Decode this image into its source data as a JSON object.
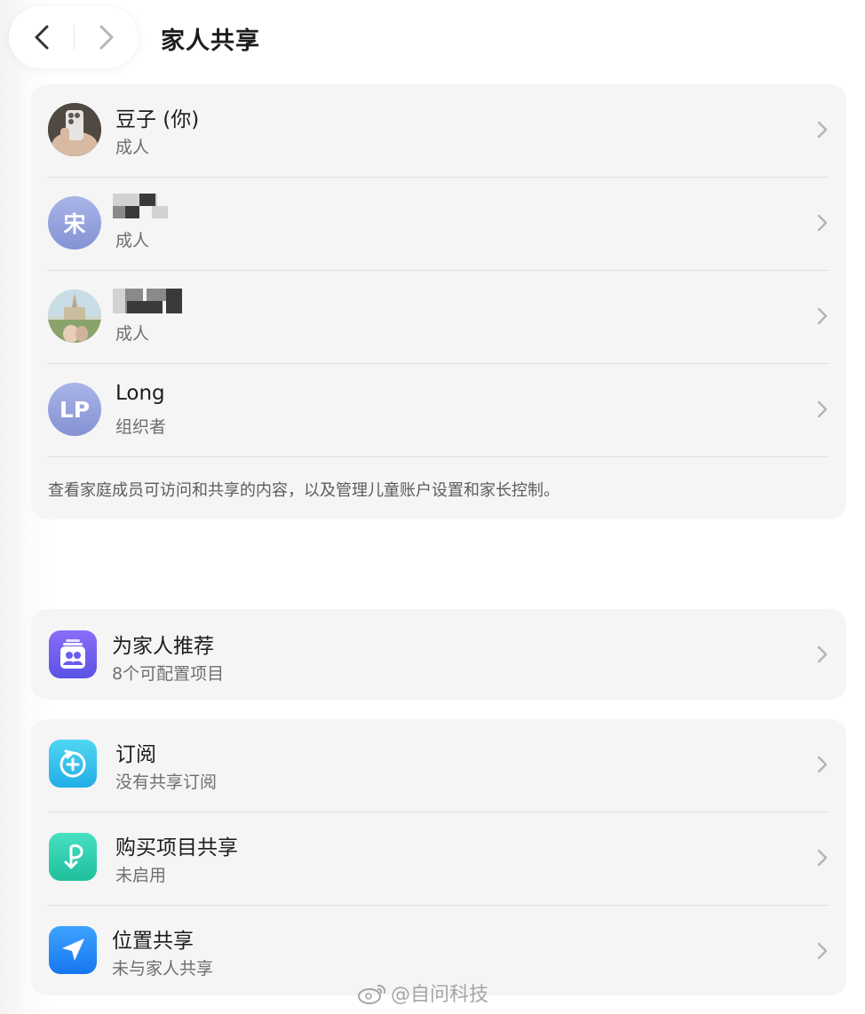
{
  "header": {
    "title": "家人共享",
    "back_icon": "chevron-left-icon",
    "forward_icon": "chevron-right-icon"
  },
  "members": [
    {
      "name": "豆子 (你)",
      "role": "成人",
      "avatar": "photo-phone-selfie"
    },
    {
      "name": "",
      "role": "成人",
      "avatar_initials": "宋"
    },
    {
      "name": "",
      "role": "成人",
      "avatar": "photo-castle"
    },
    {
      "name": "Long",
      "role": "组织者",
      "avatar_initials": "LP"
    }
  ],
  "members_footer": "查看家庭成员可访问和共享的内容，以及管理儿童账户设置和家长控制。",
  "recommend": {
    "title": "为家人推荐",
    "subtitle": "8个可配置项目",
    "icon": "family-checklist-icon"
  },
  "services": [
    {
      "title": "订阅",
      "subtitle": "没有共享订阅",
      "icon": "subscription-plus-icon"
    },
    {
      "title": "购买项目共享",
      "subtitle": "未启用",
      "icon": "purchase-sharing-icon"
    },
    {
      "title": "位置共享",
      "subtitle": "未与家人共享",
      "icon": "location-arrow-icon"
    }
  ],
  "watermark": "@自问科技",
  "colors": {
    "card_bg": "#f5f5f5",
    "avatar_gradient_top": "#a9b4e8",
    "avatar_gradient_bottom": "#8592d3",
    "recommend_icon": "#6b5cf0",
    "subscription_icon": "#3cc4ec",
    "purchase_icon": "#2fd0b0",
    "location_icon": "#1a8cff"
  }
}
